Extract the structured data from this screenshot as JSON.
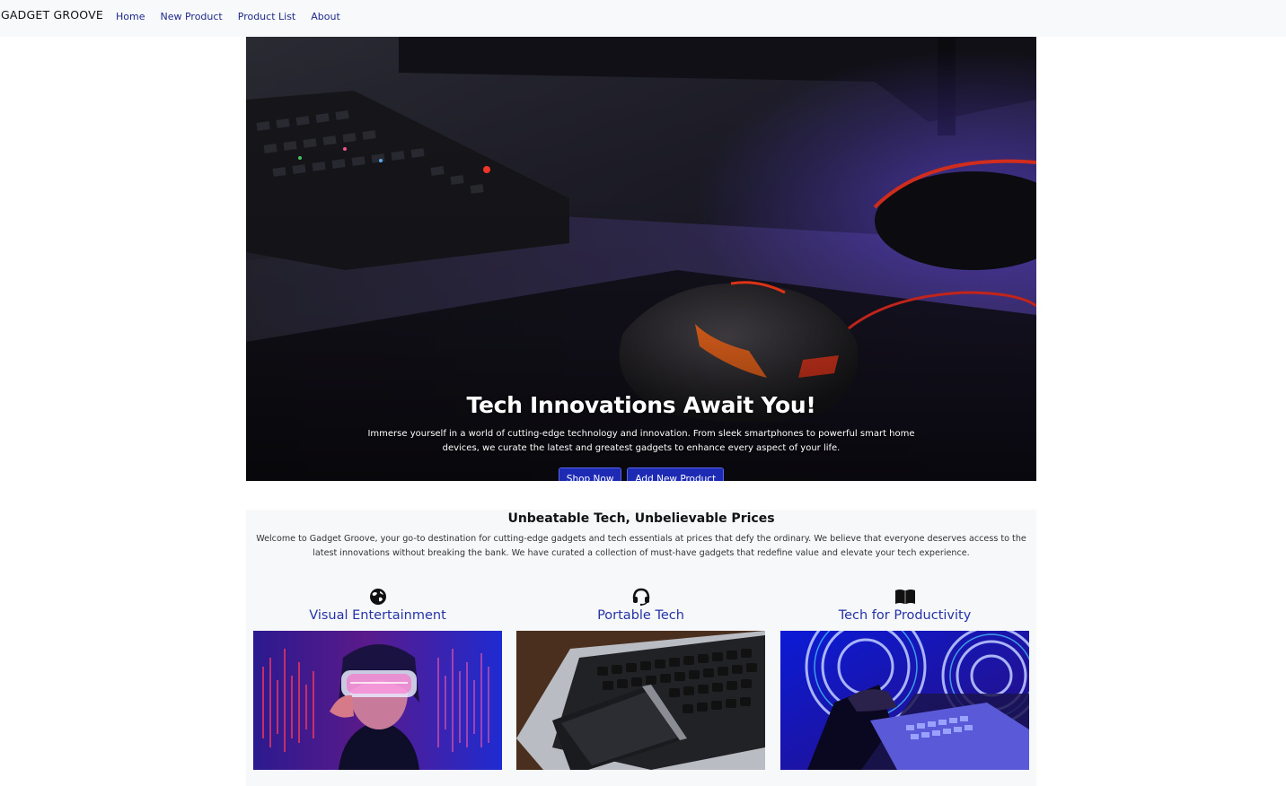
{
  "nav": {
    "brand": "GADGET GROOVE",
    "links": [
      "Home",
      "New Product",
      "Product List",
      "About"
    ]
  },
  "hero": {
    "title": "Tech Innovations Await You!",
    "text": "Immerse yourself in a world of cutting-edge technology and innovation. From sleek smartphones to powerful smart home devices, we curate the latest and greatest gadgets to enhance every aspect of your life.",
    "buttons": {
      "shop": "Shop Now",
      "add": "Add New Product"
    }
  },
  "features": {
    "title": "Unbeatable Tech, Unbelievable Prices",
    "text": "Welcome to Gadget Groove, your go-to destination for cutting-edge gadgets and tech essentials at prices that defy the ordinary. We believe that everyone deserves access to the latest innovations without breaking the bank. We have curated a collection of must-have gadgets that redefine value and elevate your tech experience.",
    "cards": [
      {
        "title": "Visual Entertainment",
        "icon": "globe-icon"
      },
      {
        "title": "Portable Tech",
        "icon": "headset-icon"
      },
      {
        "title": "Tech for Productivity",
        "icon": "book-icon"
      }
    ]
  },
  "colors": {
    "accent": "#1d2bb4",
    "link": "#1f2a8a",
    "card_title": "#2433a8"
  }
}
